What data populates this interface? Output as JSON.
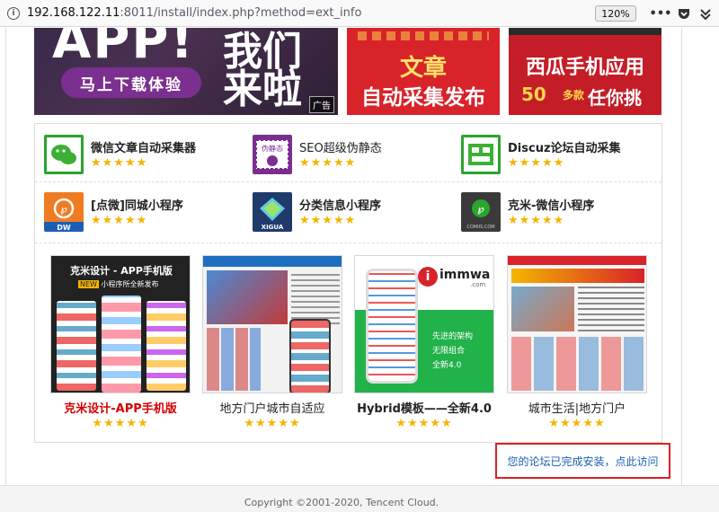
{
  "browser": {
    "url_host": "192.168.122.11",
    "url_rest": ":8011/install/index.php?method=ext_info",
    "zoom": "120%",
    "menu_icon": "ellipsis-icon",
    "pocket_icon": "pocket-icon",
    "extensions_icon": "extensions-icon"
  },
  "banners": {
    "app": {
      "big": "APP!",
      "line1": "我们",
      "line2": "来啦",
      "pill": "马上下载体验",
      "ad": "广告"
    },
    "article": {
      "line1": "文章",
      "line2": "自动采集发布"
    },
    "watermelon": {
      "line1": "西瓜手机应用",
      "price": "50",
      "unit": "多款",
      "tag": "任你挑"
    }
  },
  "stars": "★★★★★",
  "plugins": [
    {
      "name": "微信文章自动采集器",
      "icon": "wechat-icon"
    },
    {
      "name": "SEO超级伪静态",
      "icon": "seo-stamp-icon",
      "badge": "伪静态"
    },
    {
      "name": "Discuz论坛自动采集",
      "icon": "discuz-collect-icon"
    },
    {
      "name": "[点微]同城小程序",
      "icon": "dianwei-icon",
      "badge": "DW"
    },
    {
      "name": "分类信息小程序",
      "icon": "xigua-icon",
      "badge": "XIGUA"
    },
    {
      "name": "克米-微信小程序",
      "icon": "comiis-icon",
      "badge": "COMIIS.COM"
    }
  ],
  "cards": [
    {
      "title": "克米设计-APP手机版",
      "shot_title": "克米设计 - APP手机版",
      "shot_sub": "小程序所全新发布",
      "shot_new": "NEW"
    },
    {
      "title": "地方门户城市自适应"
    },
    {
      "title": "Hybrid模板——全新4.0",
      "brand": "immwa",
      "brand_sub": ".com",
      "features": [
        "先进的架构",
        "无限组合",
        "全新4.0"
      ]
    },
    {
      "title": "城市生活|地方门户"
    }
  ],
  "finish_link": "您的论坛已完成安装，点此访问",
  "copyright": "Copyright ©2001-2020, Tencent Cloud.",
  "colors": {
    "accent_red": "#e02020",
    "link_blue": "#1a5fb4",
    "star": "#f5b400"
  }
}
